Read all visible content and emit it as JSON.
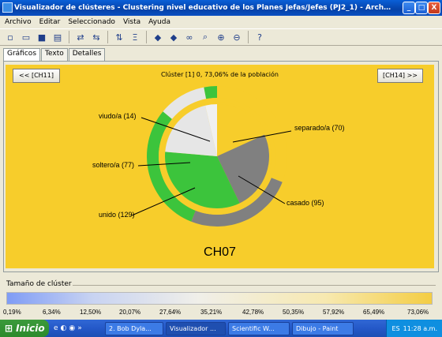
{
  "window": {
    "title": "Visualizador de clústeres - Clustering nivel educativo de los Planes Jefas/Jefes (PJ2_1) - Archivo local: general l...",
    "controls": {
      "minimize": "_",
      "maximize": "□",
      "close": "X"
    }
  },
  "menu": [
    "Archivo",
    "Editar",
    "Seleccionado",
    "Vista",
    "Ayuda"
  ],
  "toolbar": [
    "new-icon",
    "open-icon",
    "save-icon",
    "print-icon",
    "redo-icon",
    "undo-icon",
    "sort-icon",
    "filter-icon",
    "back-icon",
    "forward-icon",
    "binoculars-icon",
    "zoom-fit-icon",
    "zoom-in-icon",
    "zoom-out-icon",
    "help-icon"
  ],
  "tabs": [
    "Gráficos",
    "Texto",
    "Detalles"
  ],
  "canvas": {
    "prev_button": "<< [CH11]",
    "next_button": "[CH14] >>",
    "cluster_info": "Clúster [1] 0, 73,06% de la población",
    "chart_title": "CH07"
  },
  "chart_data": {
    "type": "pie",
    "title": "CH07",
    "categories": [
      "separado/a",
      "casado",
      "unido",
      "soltero/a",
      "viudo/a"
    ],
    "values": [
      70,
      95,
      129,
      77,
      14
    ],
    "labels": [
      "separado/a (70)",
      "casado (95)",
      "unido (129)",
      "soltero/a (77)",
      "viudo/a (14)"
    ],
    "colors": {
      "separado/a": "#f7cd2b",
      "casado": "#808080",
      "unido": "#3cc43c",
      "soltero/a": "#e6e6e6",
      "viudo/a": "#f0f0f0"
    },
    "outer_ring": [
      {
        "name": "separado/a",
        "color": "#f7cd2b",
        "value": 31
      },
      {
        "name": "casado",
        "color": "#808080",
        "value": 25
      },
      {
        "name": "unido",
        "color": "#3cc43c",
        "value": 30
      },
      {
        "name": "soltero/a",
        "color": "#e6e6e6",
        "value": 11
      },
      {
        "name": "viudo/a",
        "color": "#3cc43c",
        "value": 3
      }
    ]
  },
  "size_panel": {
    "title": "Tamaño de clúster",
    "ticks": [
      "0,19%",
      "6,34%",
      "12,50%",
      "20,07%",
      "27,64%",
      "35,21%",
      "42,78%",
      "50,35%",
      "57,92%",
      "65,49%",
      "73,06%"
    ]
  },
  "taskbar": {
    "start": "Inicio",
    "tasks": [
      "2. Bob Dyla...",
      "Visualizador ...",
      "Scientific W...",
      "Dibujo - Paint"
    ],
    "lang": "ES",
    "clock": "11:28 a.m."
  }
}
